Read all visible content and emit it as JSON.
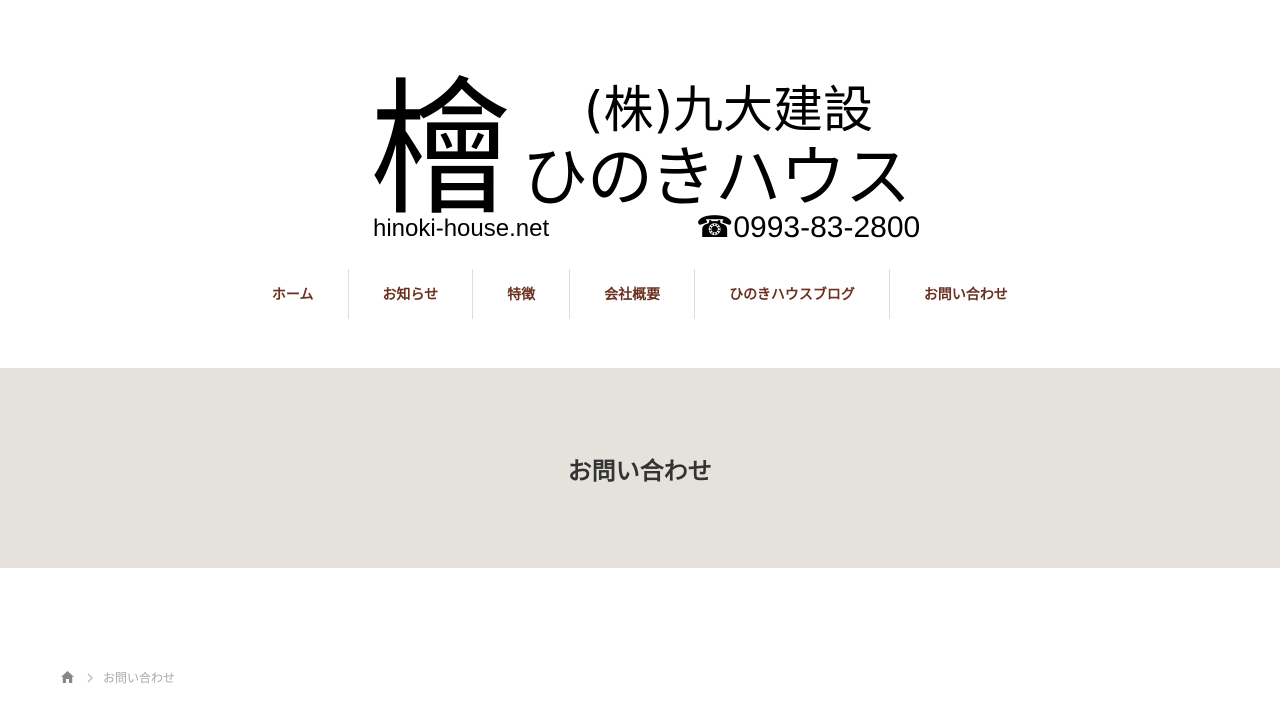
{
  "header": {
    "logo": {
      "kanji": "檜",
      "company": "(株)九大建設",
      "brand": "ひのきハウス",
      "domain": "hinoki-house.net",
      "phone": "☎0993-83-2800"
    }
  },
  "nav": {
    "items": [
      {
        "label": "ホーム"
      },
      {
        "label": "お知らせ"
      },
      {
        "label": "特徴"
      },
      {
        "label": "会社概要"
      },
      {
        "label": "ひのきハウスブログ"
      },
      {
        "label": "お問い合わせ"
      }
    ]
  },
  "page_header": {
    "title": "お問い合わせ"
  },
  "breadcrumb": {
    "home_icon": "home-icon",
    "separator_icon": "chevron-right-icon",
    "current": "お問い合わせ"
  },
  "colors": {
    "nav_text": "#6b3020",
    "header_band": "#e5e2dc",
    "title_text": "#333333",
    "breadcrumb_text": "#aaaaaa"
  }
}
